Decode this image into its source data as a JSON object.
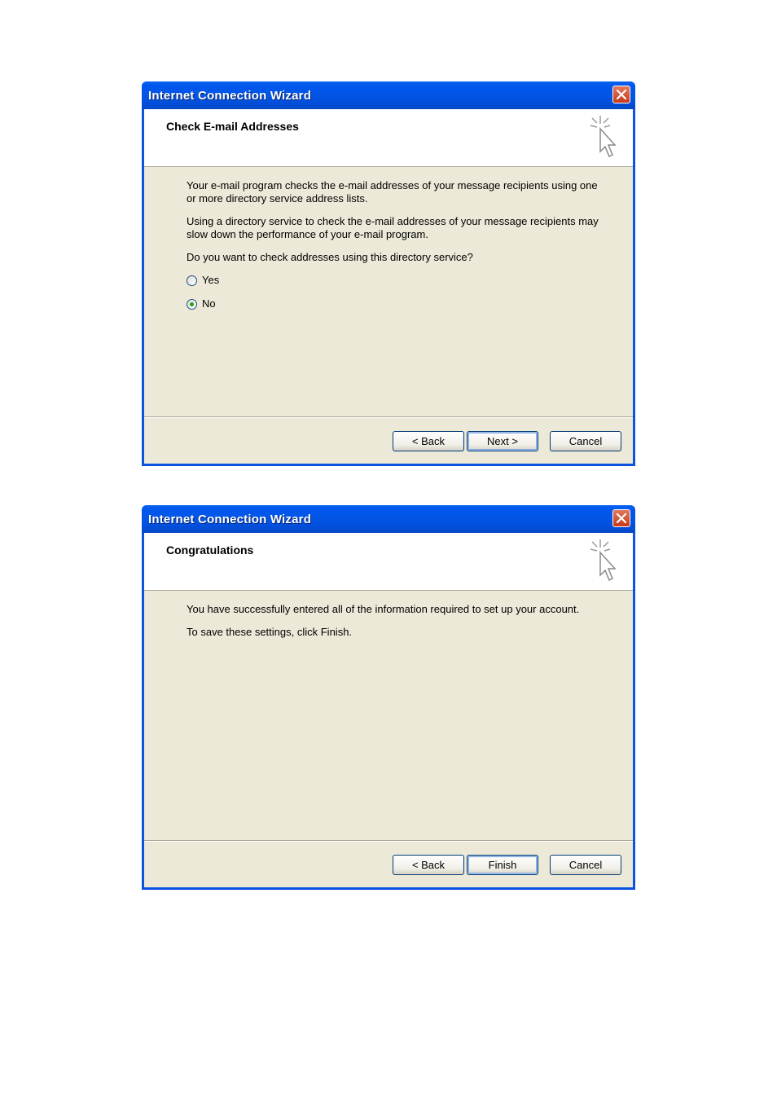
{
  "dialogs": [
    {
      "title": "Internet Connection Wizard",
      "header": "Check E-mail Addresses",
      "paragraphs": [
        "Your e-mail program checks the e-mail addresses of your message recipients using one or more directory service address lists.",
        "Using a directory service to check the e-mail addresses of your message recipients may slow down the performance of your e-mail program.",
        "Do you want to check addresses using this directory service?"
      ],
      "radios": [
        {
          "label": "Yes",
          "checked": false
        },
        {
          "label": "No",
          "checked": true
        }
      ],
      "buttons": {
        "back": "< Back",
        "next": "Next >",
        "cancel": "Cancel"
      }
    },
    {
      "title": "Internet Connection Wizard",
      "header": "Congratulations",
      "paragraphs": [
        "You have successfully entered all of the information required to set up your account.",
        "To save these settings, click Finish."
      ],
      "buttons": {
        "back": "< Back",
        "next": "Finish",
        "cancel": "Cancel"
      }
    }
  ],
  "icons": {
    "close": "close-icon",
    "wizard": "wizard-cursor-icon"
  },
  "colors": {
    "titlebar": "#0054e3",
    "client": "#ece9d8",
    "close": "#d9522f"
  }
}
